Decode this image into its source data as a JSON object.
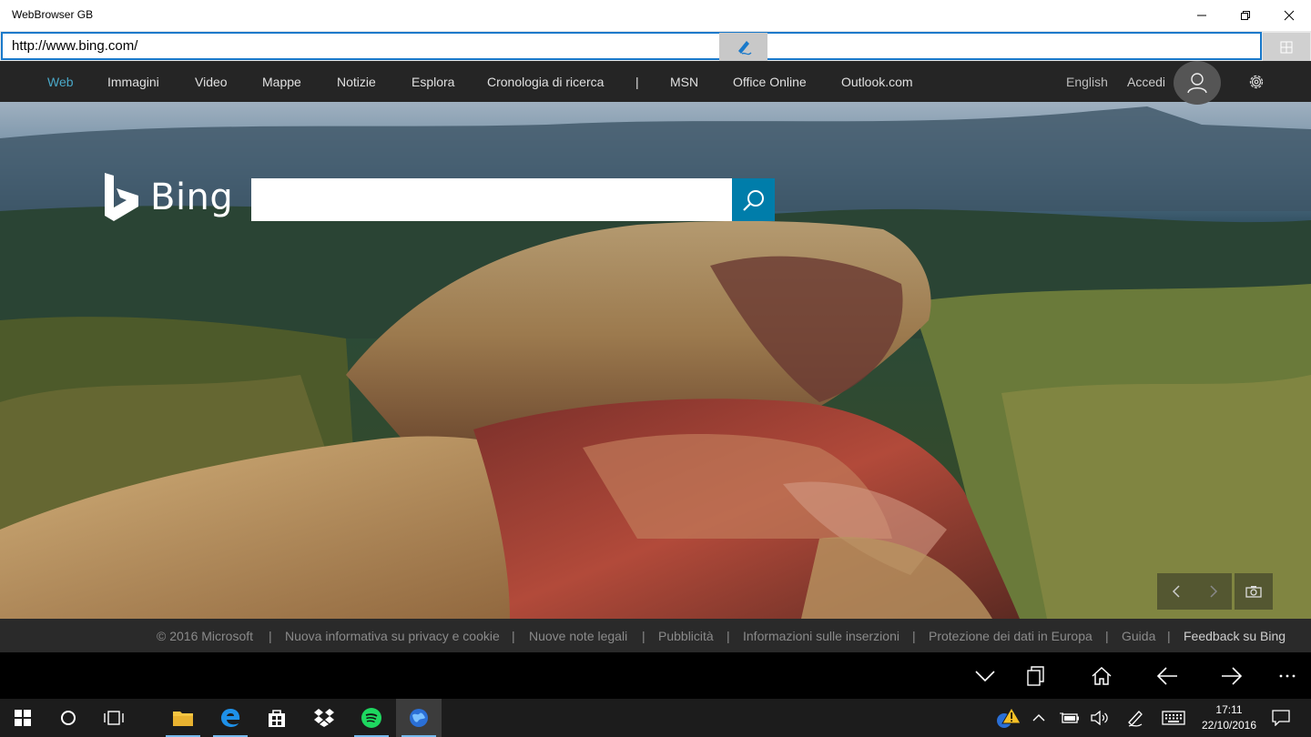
{
  "window": {
    "title": "WebBrowser GB"
  },
  "address_bar": {
    "url": "http://www.bing.com/"
  },
  "bing_nav": {
    "items": [
      {
        "label": "Web",
        "active": true
      },
      {
        "label": "Immagini"
      },
      {
        "label": "Video"
      },
      {
        "label": "Mappe"
      },
      {
        "label": "Notizie"
      },
      {
        "label": "Esplora"
      },
      {
        "label": "Cronologia di ricerca"
      },
      {
        "label": "|"
      },
      {
        "label": "MSN"
      },
      {
        "label": "Office Online"
      },
      {
        "label": "Outlook.com"
      }
    ],
    "language": "English",
    "signin": "Accedi"
  },
  "logo": {
    "text": "Bing"
  },
  "search": {
    "value": ""
  },
  "footer": {
    "items": [
      "© 2016 Microsoft",
      "Nuova informativa su privacy e cookie",
      "Nuove note legali",
      "Pubblicità",
      "Informazioni sulle inserzioni",
      "Protezione dei dati in Europa",
      "Guida",
      "Feedback su Bing"
    ]
  },
  "taskbar": {
    "apps": [
      "start-icon",
      "cortana-icon",
      "task-view-icon",
      "file-explorer-icon",
      "edge-icon",
      "store-icon",
      "dropbox-icon",
      "spotify-icon",
      "webbrowser-gb-icon"
    ],
    "clock": {
      "time": "17:11",
      "date": "22/10/2016"
    }
  },
  "colors": {
    "accent": "#007daa",
    "active_nav": "#4aa8c8",
    "taskbar": "#1c1c1c"
  }
}
